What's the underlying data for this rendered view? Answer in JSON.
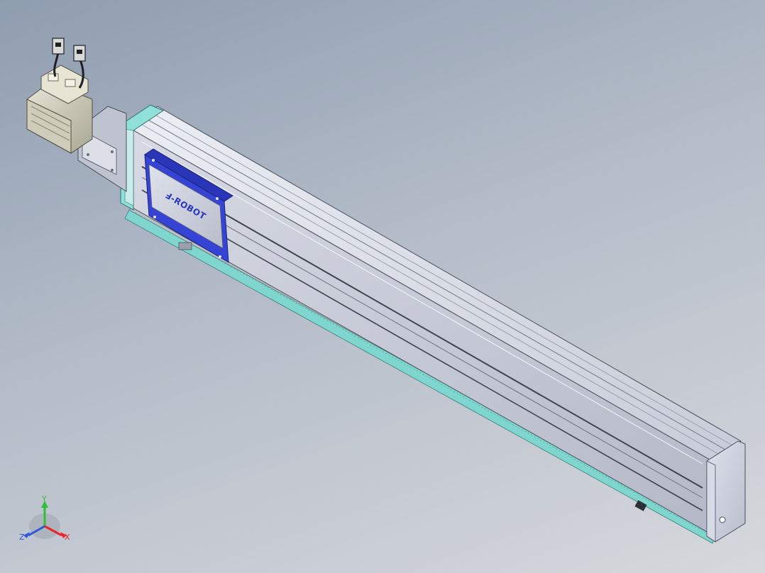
{
  "model": {
    "brand_label": "Ⅎ-ROBOT"
  },
  "triad": {
    "x_label": "X",
    "y_label": "Y",
    "z_label": "Z",
    "x_color": "#e8262a",
    "y_color": "#2fbf3a",
    "z_color": "#2f55d8"
  },
  "colors": {
    "background_top": "#8f9db0",
    "background_bottom": "#d6d8dc",
    "carriage_plate": "#2f3fd0",
    "rail_accent": "#7ed6cf",
    "profile_body": "#c9ccd8"
  }
}
